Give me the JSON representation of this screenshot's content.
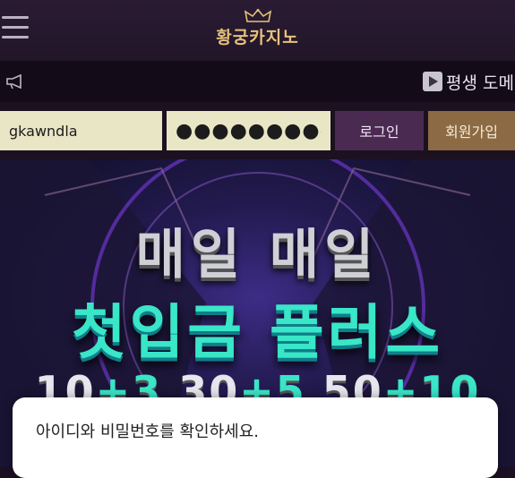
{
  "header": {
    "logo_text": "황궁카지노",
    "icons": [
      "menu-icon",
      "crown-icon"
    ]
  },
  "notice": {
    "icon": "megaphone-icon",
    "marquee_text": "평생 도메",
    "play_icon": "play-icon"
  },
  "login": {
    "id_value": "gkawndla",
    "password_value": "●●●●●●●●●●●",
    "login_label": "로그인",
    "signup_label": "회원가입"
  },
  "banner": {
    "line1": "매일 매일",
    "line2": "첫입금 플러스",
    "line3_parts": [
      "10",
      "+3",
      " 30",
      "+5",
      " 50",
      "+10"
    ]
  },
  "toast": {
    "message": "아이디와 비밀번호를 확인하세요."
  },
  "colors": {
    "header_bg": "#2a1b33",
    "input_bg": "#e9e6c6",
    "login_btn": "#4b2a52",
    "signup_btn": "#8c6a43",
    "logo_gold": "#e6c27a",
    "banner_teal": "#39e6c8"
  }
}
